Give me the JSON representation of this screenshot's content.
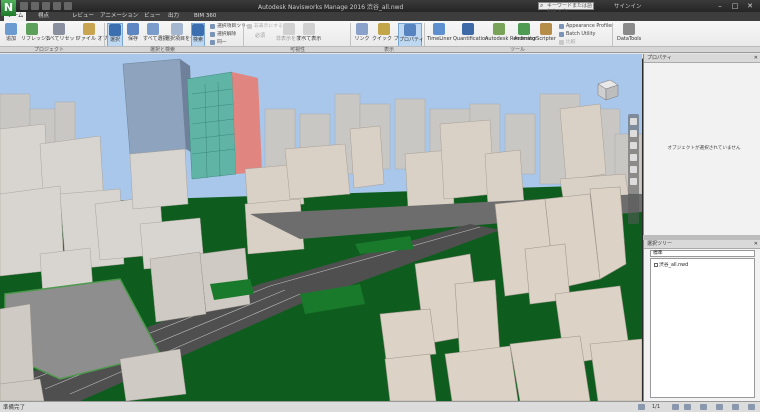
{
  "app": {
    "logo_letter": "N",
    "window_title": "Autodesk Navisworks Manage 2016  渋谷_all.nwd",
    "search_placeholder": "キーワードまたは語句を入力",
    "user_label": "サインイン",
    "window_controls": [
      "minimize-icon",
      "maximize-icon",
      "close-icon"
    ]
  },
  "tabs": [
    "ホーム",
    "視点",
    "レビュー",
    "アニメーション",
    "ビュー",
    "出力",
    "BIM 360"
  ],
  "active_tab_index": 0,
  "ribbon": {
    "project_buttons": [
      "追加",
      "リフレッシュ",
      "すべてリセット",
      "ファイル オプション"
    ],
    "select_buttons": [
      "選択",
      "保存",
      "すべて選択",
      "選択項目をセット",
      "検索"
    ],
    "select_small": [
      "選択項目ツリー",
      "選択解除",
      "選択の反転"
    ],
    "select_dropdown": "同一",
    "visibility_small": [
      "非表示にする",
      "選択対象外を非表示",
      "非表示解除"
    ],
    "visibility_buttons": [
      "必須",
      "非表示",
      "非表示を表示",
      "すべて表示"
    ],
    "display_buttons": [
      "リンク",
      "クイック プロパティ",
      "プロパティ"
    ],
    "tool_buttons": [
      "TimeLiner",
      "Quantification",
      "Autodesk Rendering",
      "Animator",
      "Scripter"
    ],
    "tool_small": [
      "Appearance Profiler",
      "Batch Utility",
      "比較"
    ],
    "datatools_label": "DataTools",
    "panel_labels": [
      "プロジェクト",
      "選択と検索",
      "可視性",
      "表示",
      "ツール"
    ]
  },
  "props_panel": {
    "title": "プロパティ",
    "message": "オブジェクトが選択されていません"
  },
  "tree_panel": {
    "title": "選択ツリー",
    "dropdown": "標準",
    "item": "渋谷_all.nwd"
  },
  "status": {
    "text": "準備完了",
    "page": "1/1"
  },
  "colors": {
    "sky": "#a9c7ea",
    "grass": "#0d5c1c",
    "building": "#d8d4cf",
    "accent_select": "#bfd8f2",
    "logo_green": "#2e8b3a"
  }
}
